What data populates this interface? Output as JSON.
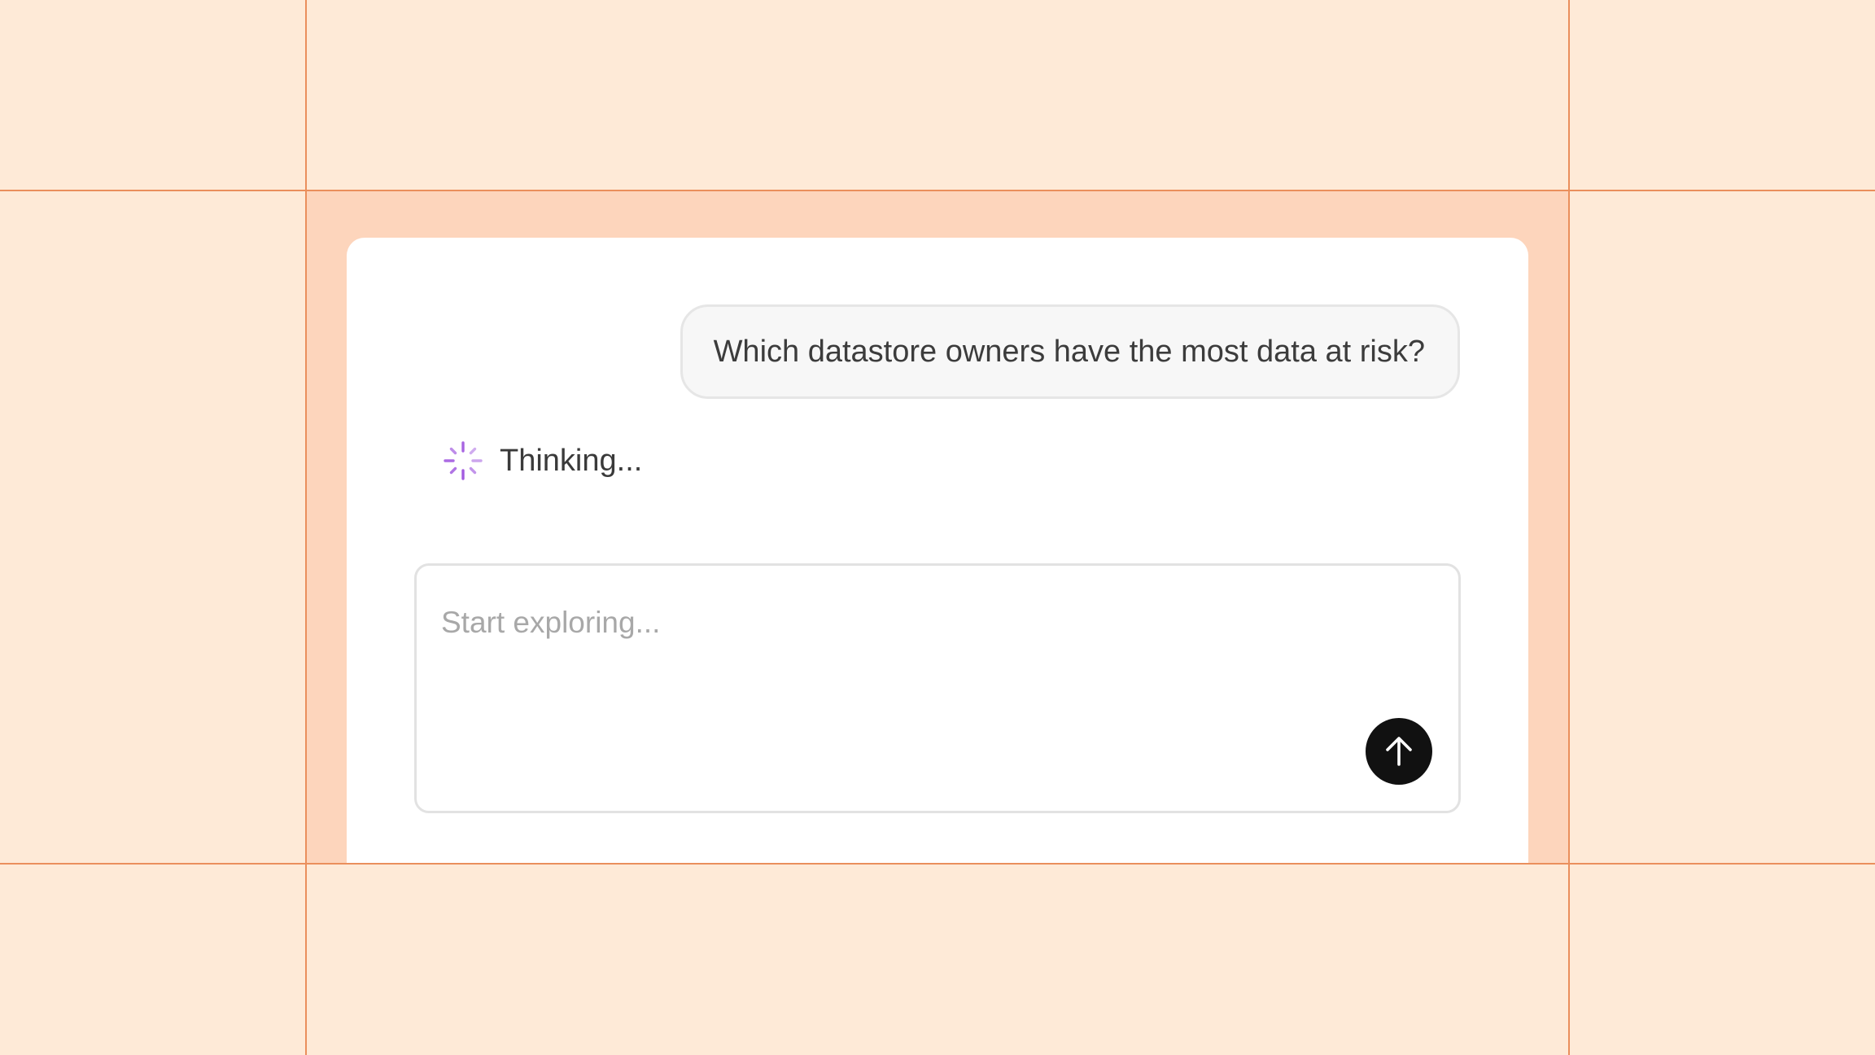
{
  "conversation": {
    "user_message": "Which datastore owners have the most data at risk?",
    "status_text": "Thinking...",
    "status_icon": "sparkle-spinner-icon",
    "status_icon_color": "#A35CE0"
  },
  "composer": {
    "placeholder": "Start exploring...",
    "value": "",
    "send_icon": "arrow-up-icon"
  },
  "colors": {
    "background": "#FEEAD7",
    "frame": "#FDD5BC",
    "grid_lines": "#EA8F5C",
    "card": "#FFFFFF",
    "send_button": "#111111"
  }
}
